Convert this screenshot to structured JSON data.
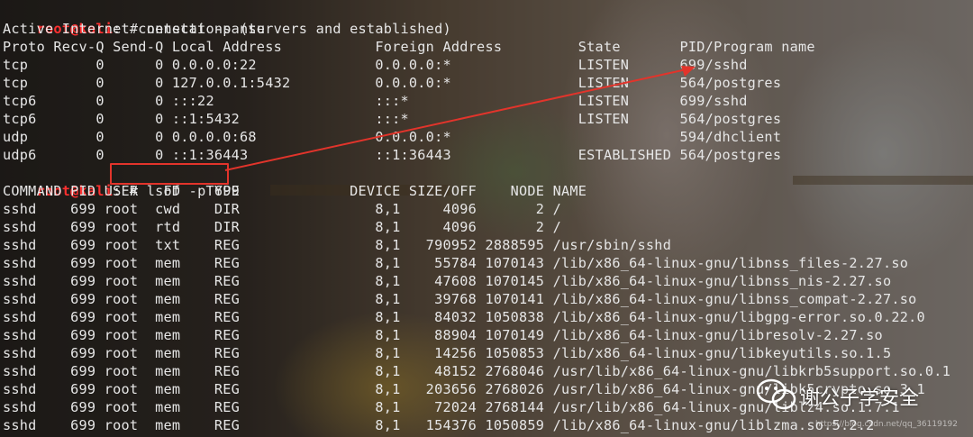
{
  "prompt1": {
    "user": "root@kali",
    "rest": ": # netstat -pantu"
  },
  "netstat": {
    "header1": "Active Internet connections (servers and established)",
    "header2": "Proto Recv-Q Send-Q Local Address           Foreign Address         State       PID/Program name",
    "rows": [
      "tcp        0      0 0.0.0.0:22              0.0.0.0:*               LISTEN      699/sshd",
      "tcp        0      0 127.0.0.1:5432          0.0.0.0:*               LISTEN      564/postgres",
      "tcp6       0      0 :::22                   :::*                    LISTEN      699/sshd",
      "tcp6       0      0 ::1:5432                :::*                    LISTEN      564/postgres",
      "udp        0      0 0.0.0.0:68              0.0.0.0:*                           594/dhclient",
      "udp6       0      0 ::1:36443               ::1:36443               ESTABLISHED 564/postgres"
    ]
  },
  "prompt2": {
    "user": "root@kali",
    "rest": ": # ",
    "command": "lsof -p 699"
  },
  "lsof": {
    "header": "COMMAND PID USER   FD   TYPE             DEVICE SIZE/OFF    NODE NAME",
    "rows": [
      "sshd    699 root  cwd    DIR                8,1     4096       2 /",
      "sshd    699 root  rtd    DIR                8,1     4096       2 /",
      "sshd    699 root  txt    REG                8,1   790952 2888595 /usr/sbin/sshd",
      "sshd    699 root  mem    REG                8,1    55784 1070143 /lib/x86_64-linux-gnu/libnss_files-2.27.so",
      "sshd    699 root  mem    REG                8,1    47608 1070145 /lib/x86_64-linux-gnu/libnss_nis-2.27.so",
      "sshd    699 root  mem    REG                8,1    39768 1070141 /lib/x86_64-linux-gnu/libnss_compat-2.27.so",
      "sshd    699 root  mem    REG                8,1    84032 1050838 /lib/x86_64-linux-gnu/libgpg-error.so.0.22.0",
      "sshd    699 root  mem    REG                8,1    88904 1070149 /lib/x86_64-linux-gnu/libresolv-2.27.so",
      "sshd    699 root  mem    REG                8,1    14256 1050853 /lib/x86_64-linux-gnu/libkeyutils.so.1.5",
      "sshd    699 root  mem    REG                8,1    48152 2768046 /usr/lib/x86_64-linux-gnu/libkrb5support.so.0.1",
      "sshd    699 root  mem    REG                8,1   203656 2768026 /usr/lib/x86_64-linux-gnu/libk5crypto.so.3.1",
      "sshd    699 root  mem    REG                8,1    72024 2768144 /usr/lib/x86_64-linux-gnu/liblz4.so.1.7.1",
      "sshd    699 root  mem    REG                8,1   154376 1050859 /lib/x86_64-linux-gnu/liblzma.so.5.2.2"
    ]
  },
  "watermark": {
    "text": "谢公子学安全",
    "url": "https://blog.csdn.net/qq_36119192"
  },
  "colors": {
    "prompt_user": "#ff3030",
    "highlight": "#e2342b",
    "text": "#e6e6e6"
  }
}
